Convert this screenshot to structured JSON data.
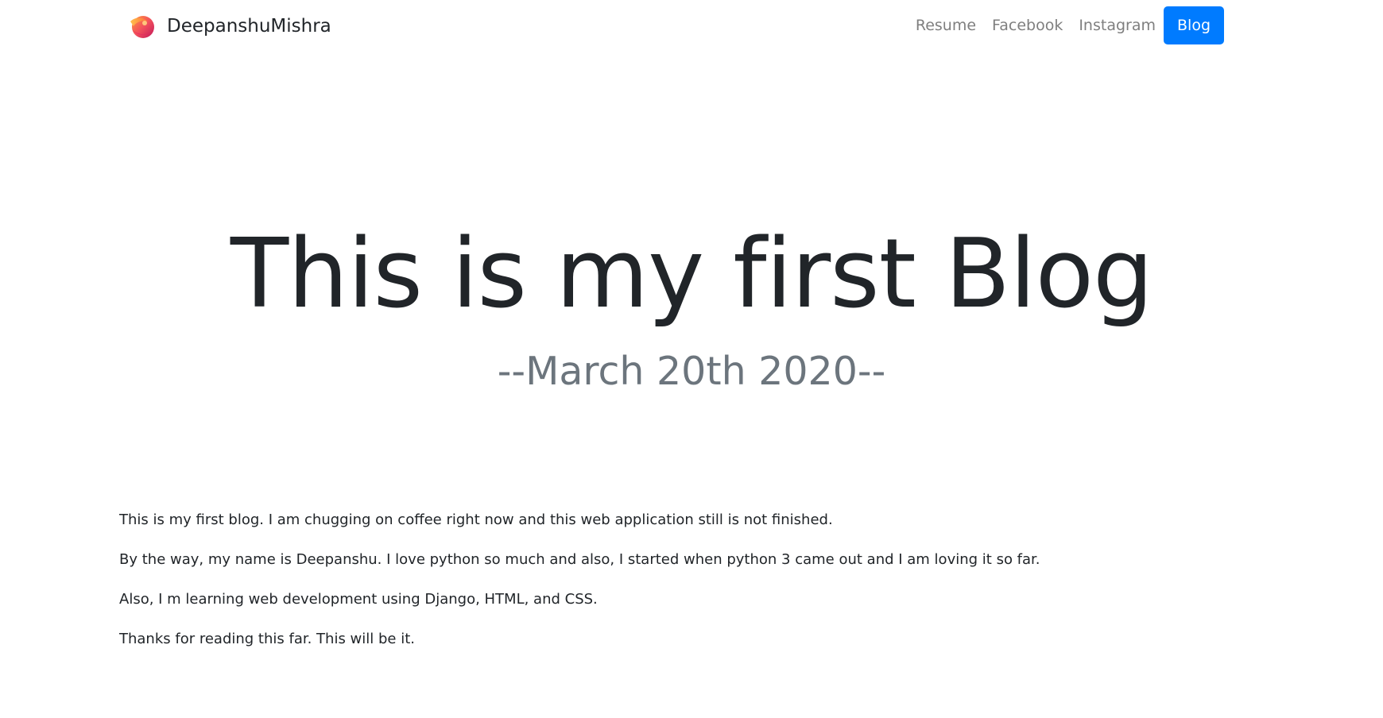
{
  "navbar": {
    "brand_name": "DeepanshuMishra",
    "logo_icon": "colorful-logo-icon",
    "links": [
      {
        "label": "Resume",
        "active": false
      },
      {
        "label": "Facebook",
        "active": false
      },
      {
        "label": "Instagram",
        "active": false
      },
      {
        "label": "Blog",
        "active": true
      }
    ],
    "active_color": "#007bff"
  },
  "hero": {
    "title": "This is my first Blog",
    "subtitle": "--March 20th 2020--"
  },
  "content": {
    "paragraphs": [
      "This is my first blog. I am chugging on coffee right now and this web application still is not finished.",
      "By the way, my name is Deepanshu. I love python so much and also, I started when python 3 came out and I am loving it so far.",
      "Also, I m learning web development using Django, HTML, and CSS.",
      "Thanks for reading this far. This will be it."
    ]
  },
  "colors": {
    "heading": "#212529",
    "subtitle": "#6c757d",
    "nav_link": "#7f7f7f"
  }
}
